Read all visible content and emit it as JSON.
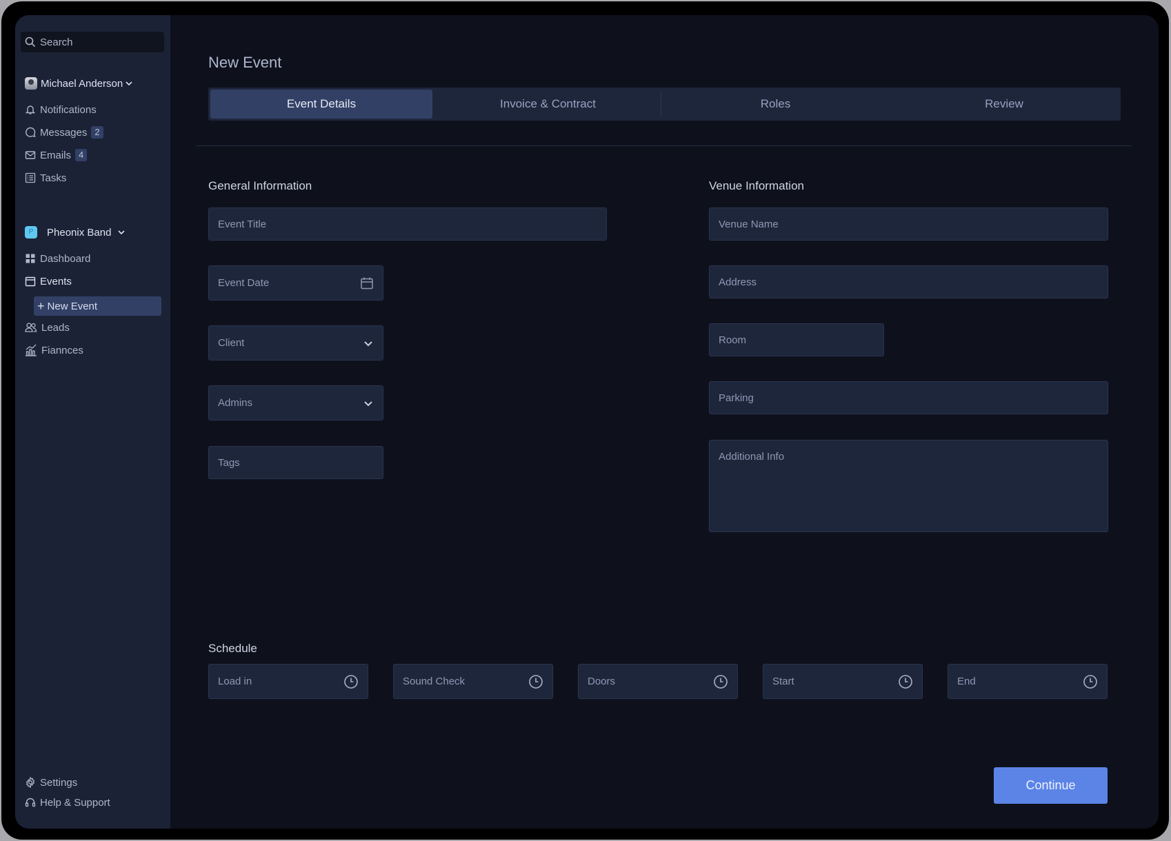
{
  "sidebar": {
    "search_placeholder": "Search",
    "user_name": "Michael Anderson",
    "top_items": [
      {
        "label": "Notifications",
        "icon": "bell-icon"
      },
      {
        "label": "Messages",
        "icon": "chat-icon",
        "badge": "2"
      },
      {
        "label": "Emails",
        "icon": "mail-icon",
        "badge": "4"
      },
      {
        "label": "Tasks",
        "icon": "tasks-icon"
      }
    ],
    "band_name": "Pheonix Band",
    "band_initial": "P",
    "band_items": [
      {
        "label": "Dashboard",
        "icon": "grid-icon"
      },
      {
        "label": "Events",
        "icon": "calendar-icon"
      },
      {
        "label": "New Event",
        "icon": "plus-icon"
      },
      {
        "label": "Leads",
        "icon": "users-icon"
      },
      {
        "label": "Fiannces",
        "icon": "chart-icon"
      }
    ],
    "bottom_items": [
      {
        "label": "Settings",
        "icon": "gear-icon"
      },
      {
        "label": "Help & Support",
        "icon": "headset-icon"
      }
    ]
  },
  "main": {
    "title": "New Event",
    "tabs": [
      "Event Details",
      "Invoice & Contract",
      "Roles",
      "Review"
    ],
    "active_tab": "Event Details",
    "general": {
      "title": "General Information",
      "event_title": "Event Title",
      "event_date": "Event Date",
      "client": "Client",
      "admins": "Admins",
      "tags": "Tags"
    },
    "venue": {
      "title": "Venue Information",
      "venue_name": "Venue Name",
      "address": "Address",
      "room": "Room",
      "parking": "Parking",
      "additional_info": "Additional Info"
    },
    "schedule": {
      "title": "Schedule",
      "fields": [
        "Load in",
        "Sound Check",
        "Doors",
        "Start",
        "End"
      ]
    },
    "continue_label": "Continue"
  },
  "colors": {
    "accent": "#5b84e6",
    "sidebar_bg": "#1b2236",
    "main_bg": "#0e111c",
    "active": "#334066"
  }
}
